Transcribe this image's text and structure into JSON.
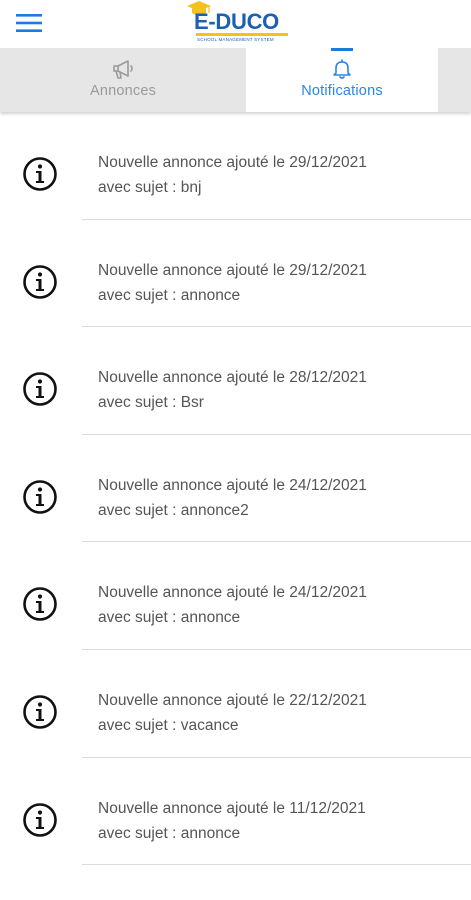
{
  "app": {
    "logo_text": "E-DUCO",
    "logo_subtitle": "SCHOOL MANAGEMENT SYSTEM",
    "brand_color": "#1d5fb0",
    "accent_color": "#f4c21a"
  },
  "tabs": [
    {
      "label": "Annonces",
      "icon": "megaphone-icon",
      "active": false
    },
    {
      "label": "Notifications",
      "icon": "bell-icon",
      "active": true
    }
  ],
  "notifications": [
    {
      "line1": "Nouvelle annonce ajouté le 29/12/2021",
      "line2": "avec sujet : bnj"
    },
    {
      "line1": "Nouvelle annonce ajouté le 29/12/2021",
      "line2": "avec sujet : annonce"
    },
    {
      "line1": "Nouvelle annonce ajouté le 28/12/2021",
      "line2": "avec sujet : Bsr"
    },
    {
      "line1": "Nouvelle annonce ajouté le 24/12/2021",
      "line2": "avec sujet : annonce2"
    },
    {
      "line1": "Nouvelle annonce ajouté le 24/12/2021",
      "line2": "avec sujet : annonce"
    },
    {
      "line1": "Nouvelle annonce ajouté le 22/12/2021",
      "line2": "avec sujet : vacance"
    },
    {
      "line1": "Nouvelle annonce ajouté le 11/12/2021",
      "line2": "avec sujet : annonce"
    }
  ]
}
